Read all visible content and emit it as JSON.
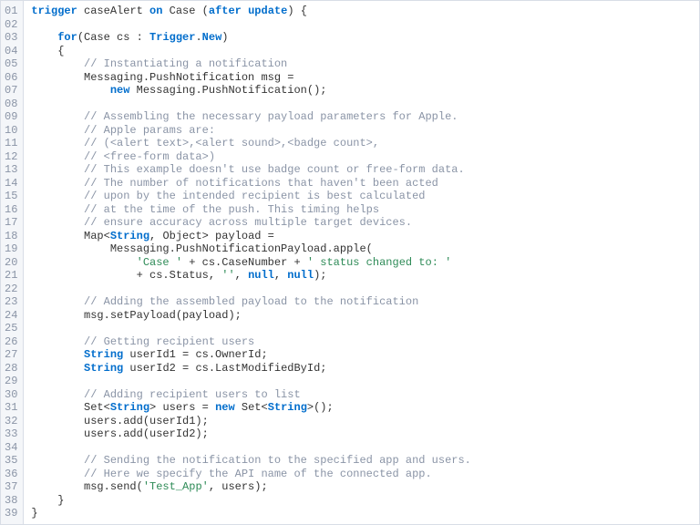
{
  "code": {
    "line_count": 39,
    "lines": [
      [
        [
          "kw",
          "trigger"
        ],
        [
          "txt",
          " caseAlert "
        ],
        [
          "kw",
          "on"
        ],
        [
          "txt",
          " Case ("
        ],
        [
          "kw",
          "after"
        ],
        [
          "txt",
          " "
        ],
        [
          "kw",
          "update"
        ],
        [
          "txt",
          ") {"
        ]
      ],
      [],
      [
        [
          "txt",
          "    "
        ],
        [
          "kw",
          "for"
        ],
        [
          "txt",
          "(Case cs : "
        ],
        [
          "kw",
          "Trigger"
        ],
        [
          "txt",
          "."
        ],
        [
          "kw",
          "New"
        ],
        [
          "txt",
          ")"
        ]
      ],
      [
        [
          "txt",
          "    {"
        ]
      ],
      [
        [
          "txt",
          "        "
        ],
        [
          "com",
          "// Instantiating a notification"
        ]
      ],
      [
        [
          "txt",
          "        Messaging.PushNotification msg ="
        ]
      ],
      [
        [
          "txt",
          "            "
        ],
        [
          "kw",
          "new"
        ],
        [
          "txt",
          " Messaging.PushNotification();"
        ]
      ],
      [],
      [
        [
          "txt",
          "        "
        ],
        [
          "com",
          "// Assembling the necessary payload parameters for Apple."
        ]
      ],
      [
        [
          "txt",
          "        "
        ],
        [
          "com",
          "// Apple params are:"
        ]
      ],
      [
        [
          "txt",
          "        "
        ],
        [
          "com",
          "// (<alert text>,<alert sound>,<badge count>,"
        ]
      ],
      [
        [
          "txt",
          "        "
        ],
        [
          "com",
          "// <free-form data>)"
        ]
      ],
      [
        [
          "txt",
          "        "
        ],
        [
          "com",
          "// This example doesn't use badge count or free-form data."
        ]
      ],
      [
        [
          "txt",
          "        "
        ],
        [
          "com",
          "// The number of notifications that haven't been acted"
        ]
      ],
      [
        [
          "txt",
          "        "
        ],
        [
          "com",
          "// upon by the intended recipient is best calculated"
        ]
      ],
      [
        [
          "txt",
          "        "
        ],
        [
          "com",
          "// at the time of the push. This timing helps"
        ]
      ],
      [
        [
          "txt",
          "        "
        ],
        [
          "com",
          "// ensure accuracy across multiple target devices."
        ]
      ],
      [
        [
          "txt",
          "        Map<"
        ],
        [
          "type",
          "String"
        ],
        [
          "txt",
          ", Object> payload ="
        ]
      ],
      [
        [
          "txt",
          "            Messaging.PushNotificationPayload.apple("
        ]
      ],
      [
        [
          "txt",
          "                "
        ],
        [
          "str",
          "'Case '"
        ],
        [
          "txt",
          " + cs.CaseNumber + "
        ],
        [
          "str",
          "' status changed to: '"
        ]
      ],
      [
        [
          "txt",
          "                + cs.Status, "
        ],
        [
          "str",
          "''"
        ],
        [
          "txt",
          ", "
        ],
        [
          "kw",
          "null"
        ],
        [
          "txt",
          ", "
        ],
        [
          "kw",
          "null"
        ],
        [
          "txt",
          ");"
        ]
      ],
      [],
      [
        [
          "txt",
          "        "
        ],
        [
          "com",
          "// Adding the assembled payload to the notification"
        ]
      ],
      [
        [
          "txt",
          "        msg.setPayload(payload);"
        ]
      ],
      [],
      [
        [
          "txt",
          "        "
        ],
        [
          "com",
          "// Getting recipient users"
        ]
      ],
      [
        [
          "txt",
          "        "
        ],
        [
          "type",
          "String"
        ],
        [
          "txt",
          " userId1 = cs.OwnerId;"
        ]
      ],
      [
        [
          "txt",
          "        "
        ],
        [
          "type",
          "String"
        ],
        [
          "txt",
          " userId2 = cs.LastModifiedById;"
        ]
      ],
      [],
      [
        [
          "txt",
          "        "
        ],
        [
          "com",
          "// Adding recipient users to list"
        ]
      ],
      [
        [
          "txt",
          "        Set<"
        ],
        [
          "type",
          "String"
        ],
        [
          "txt",
          "> users = "
        ],
        [
          "kw",
          "new"
        ],
        [
          "txt",
          " Set<"
        ],
        [
          "type",
          "String"
        ],
        [
          "txt",
          ">();"
        ]
      ],
      [
        [
          "txt",
          "        users.add(userId1);"
        ]
      ],
      [
        [
          "txt",
          "        users.add(userId2);"
        ]
      ],
      [],
      [
        [
          "txt",
          "        "
        ],
        [
          "com",
          "// Sending the notification to the specified app and users."
        ]
      ],
      [
        [
          "txt",
          "        "
        ],
        [
          "com",
          "// Here we specify the API name of the connected app."
        ]
      ],
      [
        [
          "txt",
          "        msg.send("
        ],
        [
          "str",
          "'Test_App'"
        ],
        [
          "txt",
          ", users);"
        ]
      ],
      [
        [
          "txt",
          "    }"
        ]
      ],
      [
        [
          "txt",
          "}"
        ]
      ]
    ]
  }
}
